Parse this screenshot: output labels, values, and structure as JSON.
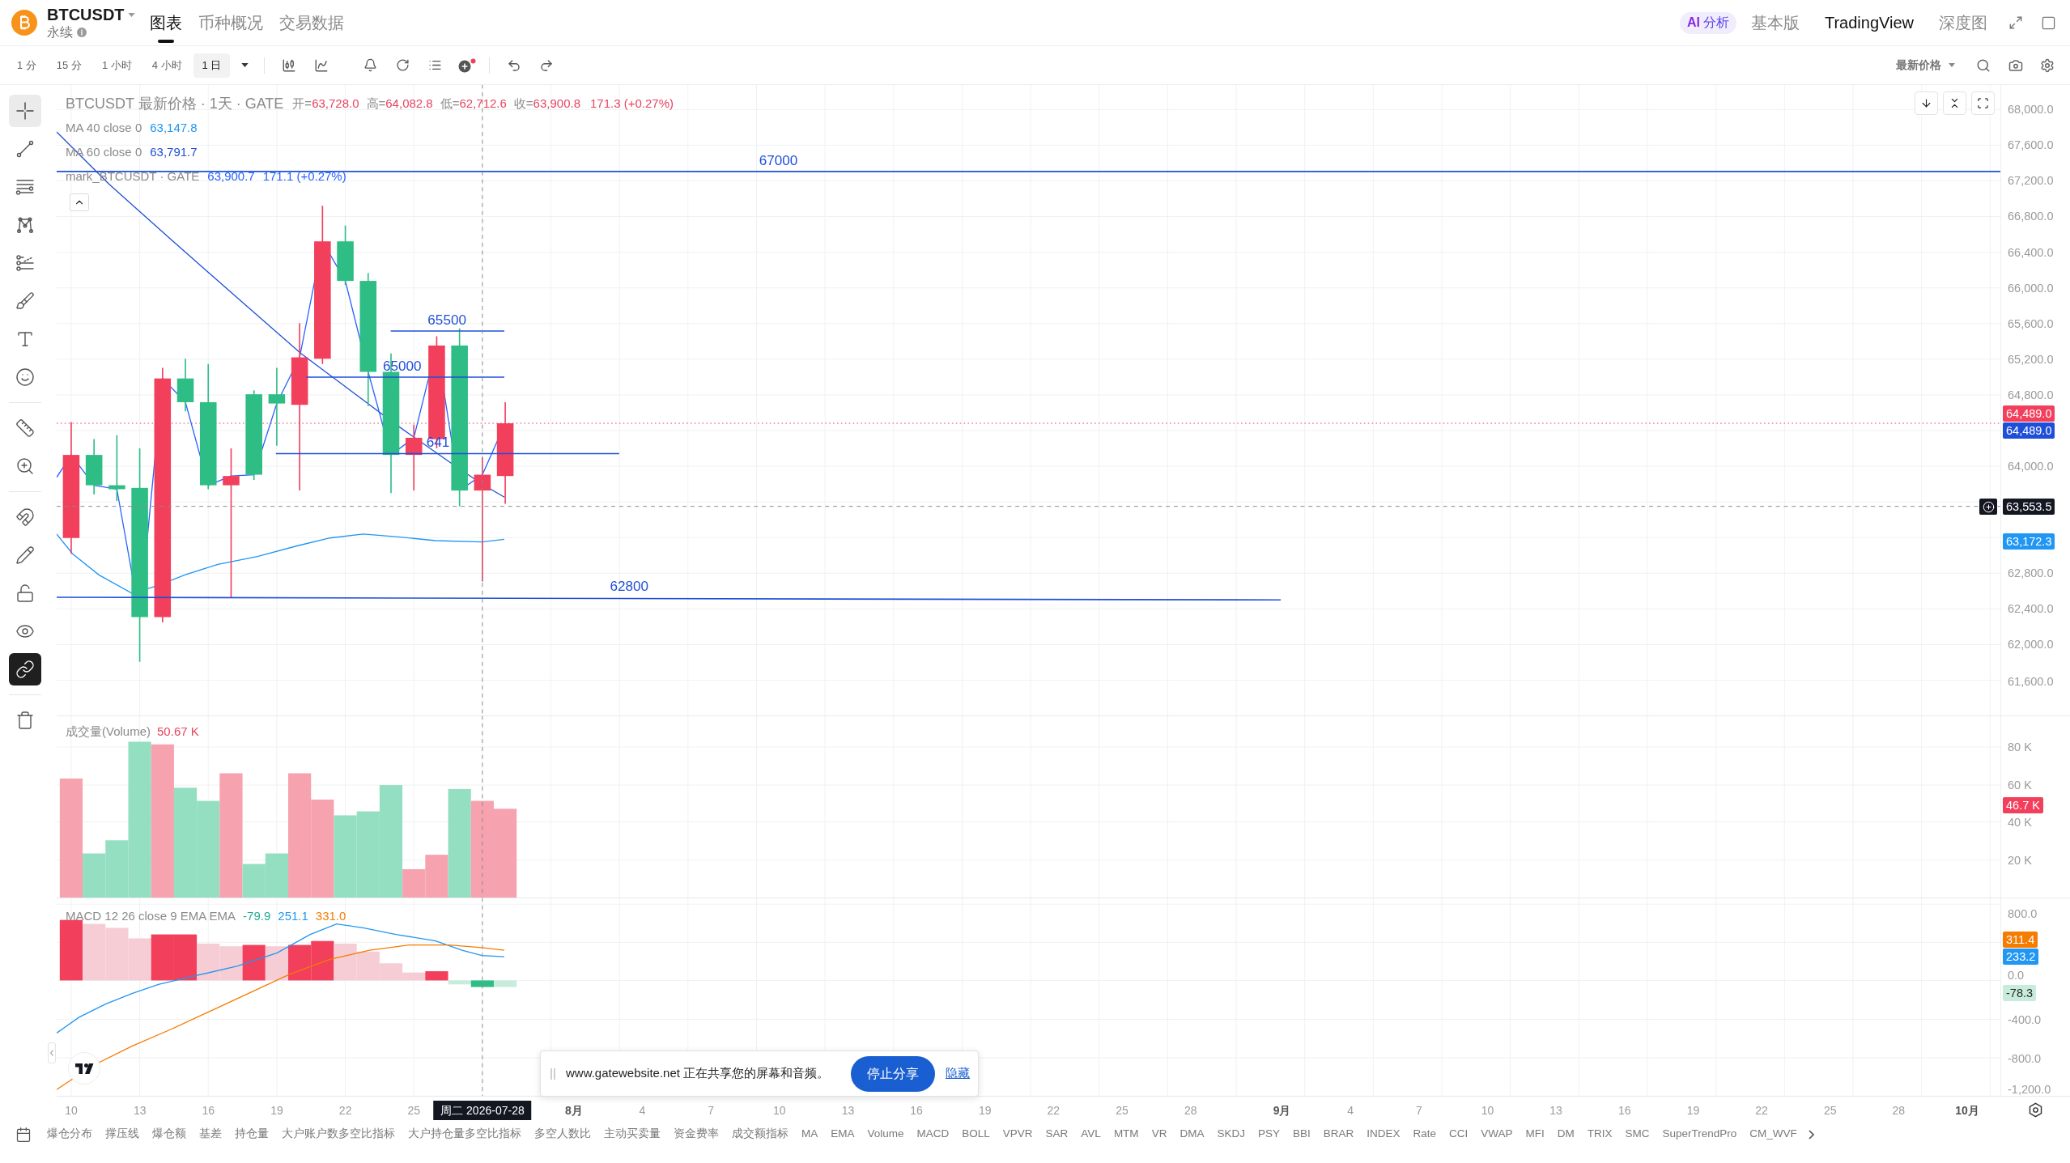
{
  "header": {
    "symbol": "BTCUSDT",
    "contract_type": "永续",
    "tabs": [
      {
        "label": "图表",
        "selected": true
      },
      {
        "label": "币种概况",
        "selected": false
      },
      {
        "label": "交易数据",
        "selected": false
      }
    ],
    "ai_button": {
      "badge": "AI",
      "label": "分析"
    },
    "view_modes": [
      {
        "label": "基本版",
        "selected": false
      },
      {
        "label": "TradingView",
        "selected": true
      },
      {
        "label": "深度图",
        "selected": false
      }
    ]
  },
  "toolbar": {
    "intervals": [
      {
        "label": "1 分",
        "selected": false
      },
      {
        "label": "15 分",
        "selected": false
      },
      {
        "label": "1 小时",
        "selected": false
      },
      {
        "label": "4 小时",
        "selected": false
      },
      {
        "label": "1 日",
        "selected": true
      }
    ],
    "price_source": "最新价格"
  },
  "drawing_toolbar": {
    "tools": [
      {
        "selected": true
      },
      {
        "selected": false
      },
      {
        "selected": false
      },
      {
        "selected": false
      },
      {
        "selected": false
      },
      {
        "selected": false
      },
      {
        "selected": false
      },
      {
        "selected": false
      }
    ],
    "measure_tools": [
      {
        "selected": false
      },
      {
        "selected": false
      }
    ],
    "toggles": [
      {
        "on": false
      },
      {
        "on": false
      },
      {
        "on": false
      },
      {
        "on": false
      },
      {
        "on": true
      }
    ]
  },
  "price_pane": {
    "legend": {
      "title": "BTCUSDT 最新价格 · 1天 · GATE",
      "ohlc": [
        {
          "label": "开=",
          "value": "63,728.0"
        },
        {
          "label": "高=",
          "value": "64,082.8"
        },
        {
          "label": "低=",
          "value": "62,712.6"
        },
        {
          "label": "收=",
          "value": "63,900.8"
        }
      ],
      "change": "171.3 (+0.27%)"
    },
    "indicators": [
      {
        "name": "MA 40 close 0",
        "value": "63,147.8",
        "color": "#2196f3"
      },
      {
        "name": "MA 60 close 0",
        "value": "63,791.7",
        "color": "#1f4fd8"
      }
    ],
    "mark_price": {
      "name": "mark_BTCUSDT · GATE",
      "value": "63,900.7",
      "change": "171.1 (+0.27%)"
    },
    "drawn_lines": [
      {
        "label": "67000"
      },
      {
        "label": "65500"
      },
      {
        "label": "65000"
      },
      {
        "label": "641"
      },
      {
        "label": "62800"
      }
    ],
    "axis_ticks": [
      "68,000.0",
      "67,600.0",
      "67,200.0",
      "66,800.0",
      "66,400.0",
      "66,000.0",
      "65,600.0",
      "65,200.0",
      "64,800.0",
      "64,000.0",
      "62,800.0",
      "62,400.0",
      "62,000.0",
      "61,600.0"
    ],
    "axis_markers": [
      {
        "value": "64,489.0",
        "color": "#f23f5c"
      },
      {
        "value": "64,489.0",
        "color": "#1f4fd8"
      },
      {
        "value": "63,172.3",
        "color": "#2196f3"
      }
    ],
    "crosshair_price": "63,553.5"
  },
  "volume_pane": {
    "title": "成交量(Volume)",
    "value": "50.67 K",
    "axis_ticks": [
      "80 K",
      "60 K",
      "40 K",
      "20 K"
    ],
    "axis_marker": "46.7 K"
  },
  "macd_pane": {
    "title": "MACD 12 26 close 9 EMA EMA",
    "values": [
      {
        "value": "-79.9",
        "color": "#22ab94"
      },
      {
        "value": "251.1",
        "color": "#2196f3"
      },
      {
        "value": "331.0",
        "color": "#f57c00"
      }
    ],
    "axis_ticks": [
      "800.0",
      "0.0",
      "-400.0",
      "-800.0",
      "-1,200.0"
    ],
    "axis_markers": [
      {
        "value": "311.4",
        "color": "#f57c00"
      },
      {
        "value": "233.2",
        "color": "#2196f3"
      },
      {
        "value": "-78.3",
        "color": "#c8ecdc"
      }
    ]
  },
  "time_axis": {
    "labels": [
      {
        "text": "10",
        "kind": "day"
      },
      {
        "text": "13",
        "kind": "day"
      },
      {
        "text": "16",
        "kind": "day"
      },
      {
        "text": "19",
        "kind": "day"
      },
      {
        "text": "22",
        "kind": "day"
      },
      {
        "text": "25",
        "kind": "day"
      },
      {
        "text": "8月",
        "kind": "month"
      },
      {
        "text": "4",
        "kind": "day"
      },
      {
        "text": "7",
        "kind": "day"
      },
      {
        "text": "10",
        "kind": "day"
      },
      {
        "text": "13",
        "kind": "day"
      },
      {
        "text": "16",
        "kind": "day"
      },
      {
        "text": "19",
        "kind": "day"
      },
      {
        "text": "22",
        "kind": "day"
      },
      {
        "text": "25",
        "kind": "day"
      },
      {
        "text": "28",
        "kind": "day"
      },
      {
        "text": "9月",
        "kind": "month"
      },
      {
        "text": "4",
        "kind": "day"
      },
      {
        "text": "7",
        "kind": "day"
      },
      {
        "text": "10",
        "kind": "day"
      },
      {
        "text": "13",
        "kind": "day"
      },
      {
        "text": "16",
        "kind": "day"
      },
      {
        "text": "19",
        "kind": "day"
      },
      {
        "text": "22",
        "kind": "day"
      },
      {
        "text": "25",
        "kind": "day"
      },
      {
        "text": "28",
        "kind": "day"
      },
      {
        "text": "10月",
        "kind": "month"
      }
    ],
    "crosshair_date": "周二 2026-07-28"
  },
  "share_banner": {
    "message": "www.gatewebsite.net 正在共享您的屏幕和音频。",
    "stop_button": "停止分享",
    "hide_link": "隐藏"
  },
  "indicator_bar": [
    "爆仓分布",
    "撑压线",
    "爆仓额",
    "基差",
    "持仓量",
    "大户账户数多空比指标",
    "大户持仓量多空比指标",
    "多空人数比",
    "主动买卖量",
    "资金费率",
    "成交额指标",
    "MA",
    "EMA",
    "Volume",
    "MACD",
    "BOLL",
    "VPVR",
    "SAR",
    "AVL",
    "MTM",
    "VR",
    "DMA",
    "SKDJ",
    "PSY",
    "BBI",
    "BRAR",
    "INDEX",
    "Rate",
    "CCI",
    "VWAP",
    "MFI",
    "DM",
    "TRIX",
    "SMC",
    "SuperTrendPro",
    "CM_WVF"
  ]
}
